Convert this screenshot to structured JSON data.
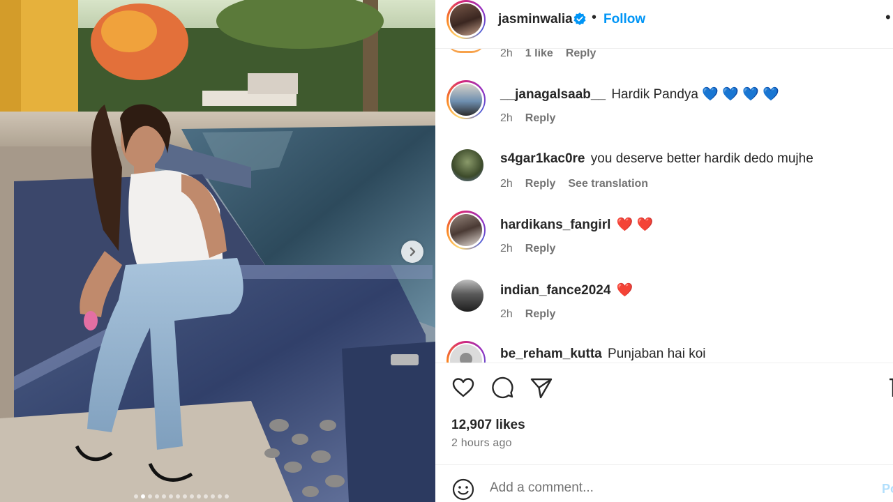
{
  "post": {
    "username": "jasminwalia",
    "verified": true,
    "separator": "•",
    "follow_label": "Follow",
    "more_icon": "more-icon",
    "carousel_dot_count": 14,
    "carousel_active_index": 1
  },
  "previous_comment": {
    "time": "2h",
    "likes": "1 like",
    "reply_label": "Reply"
  },
  "comments": [
    {
      "username": "__janagalsaab__",
      "text": "Hardik Pandya 💙 💙 💙 💙",
      "time": "2h",
      "reply_label": "Reply",
      "story_ring": true
    },
    {
      "username": "s4gar1kac0re",
      "text": "you deserve better hardik dedo mujhe",
      "time": "2h",
      "reply_label": "Reply",
      "translation_label": "See translation",
      "story_ring": false
    },
    {
      "username": "hardikans_fangirl",
      "text": "❤️ ❤️",
      "time": "2h",
      "reply_label": "Reply",
      "story_ring": true
    },
    {
      "username": "indian_fance2024",
      "text": "❤️",
      "time": "2h",
      "reply_label": "Reply",
      "story_ring": false
    },
    {
      "username": "be_reham_kutta",
      "text": "Punjaban hai koi",
      "time": "",
      "reply_label": "",
      "story_ring": true
    }
  ],
  "actions": {
    "like_icon": "heart-icon",
    "comment_icon": "comment-icon",
    "share_icon": "share-icon",
    "save_icon": "bookmark-icon",
    "likes_text": "12,907 likes",
    "time_ago": "2 hours ago"
  },
  "add_comment": {
    "placeholder": "Add a comment...",
    "post_label": "Po",
    "emoji_icon": "emoji-icon"
  },
  "colors": {
    "accent": "#0095f6",
    "secondary_text": "#737373",
    "primary_text": "#262626",
    "heart": "#ed4956",
    "blue_heart": "#1877f2"
  }
}
